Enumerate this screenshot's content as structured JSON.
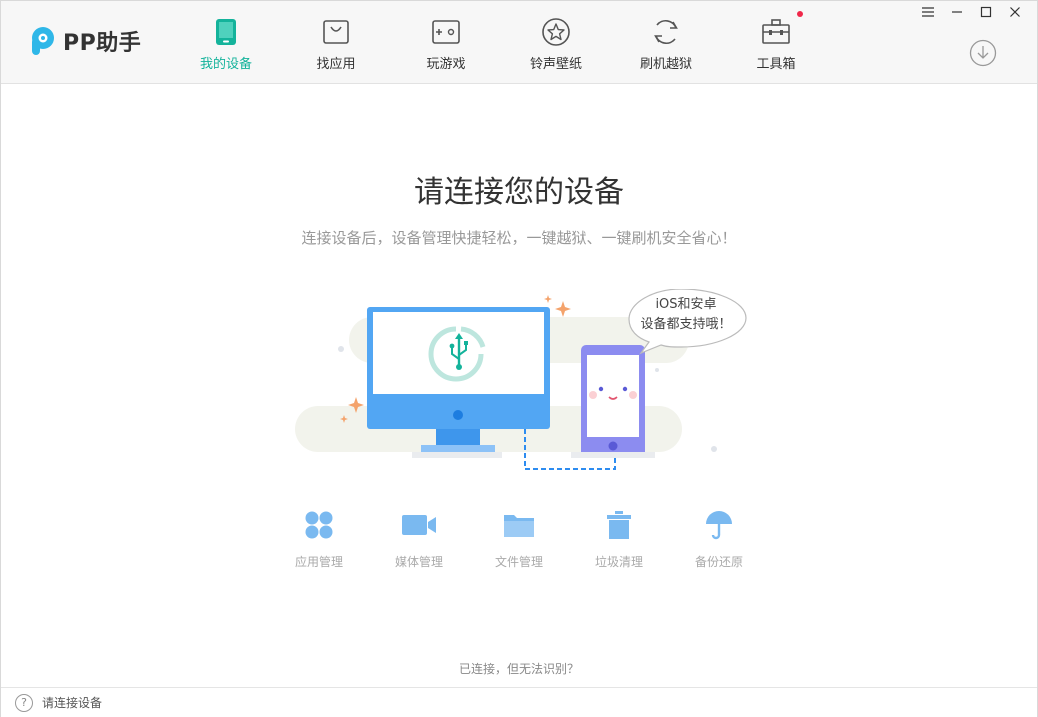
{
  "app": {
    "name": "PP助手",
    "brand_color": "#2fb7e8",
    "accent_color": "#14b39b"
  },
  "nav": {
    "items": [
      {
        "label": "我的设备",
        "icon": "phone-icon",
        "active": true
      },
      {
        "label": "找应用",
        "icon": "shopping-bag-icon"
      },
      {
        "label": "玩游戏",
        "icon": "gamepad-icon"
      },
      {
        "label": "铃声壁纸",
        "icon": "star-icon"
      },
      {
        "label": "刷机越狱",
        "icon": "refresh-icon"
      },
      {
        "label": "工具箱",
        "icon": "toolbox-icon",
        "badge": true
      }
    ]
  },
  "window_controls": {
    "menu": "menu-icon",
    "minimize": "minimize-icon",
    "maximize": "maximize-icon",
    "close": "close-icon"
  },
  "main": {
    "title": "请连接您的设备",
    "subtitle": "连接设备后，设备管理快捷轻松，一键越狱、一键刷机安全省心！",
    "bubble_line1": "iOS和安卓",
    "bubble_line2": "设备都支持哦！"
  },
  "features": [
    {
      "label": "应用管理",
      "icon": "apps-grid-icon"
    },
    {
      "label": "媒体管理",
      "icon": "video-camera-icon"
    },
    {
      "label": "文件管理",
      "icon": "folder-icon"
    },
    {
      "label": "垃圾清理",
      "icon": "trash-icon"
    },
    {
      "label": "备份还原",
      "icon": "umbrella-icon"
    }
  ],
  "help_link": "已连接，但无法识别？",
  "status": {
    "text": "请连接设备",
    "icon": "help-icon"
  }
}
